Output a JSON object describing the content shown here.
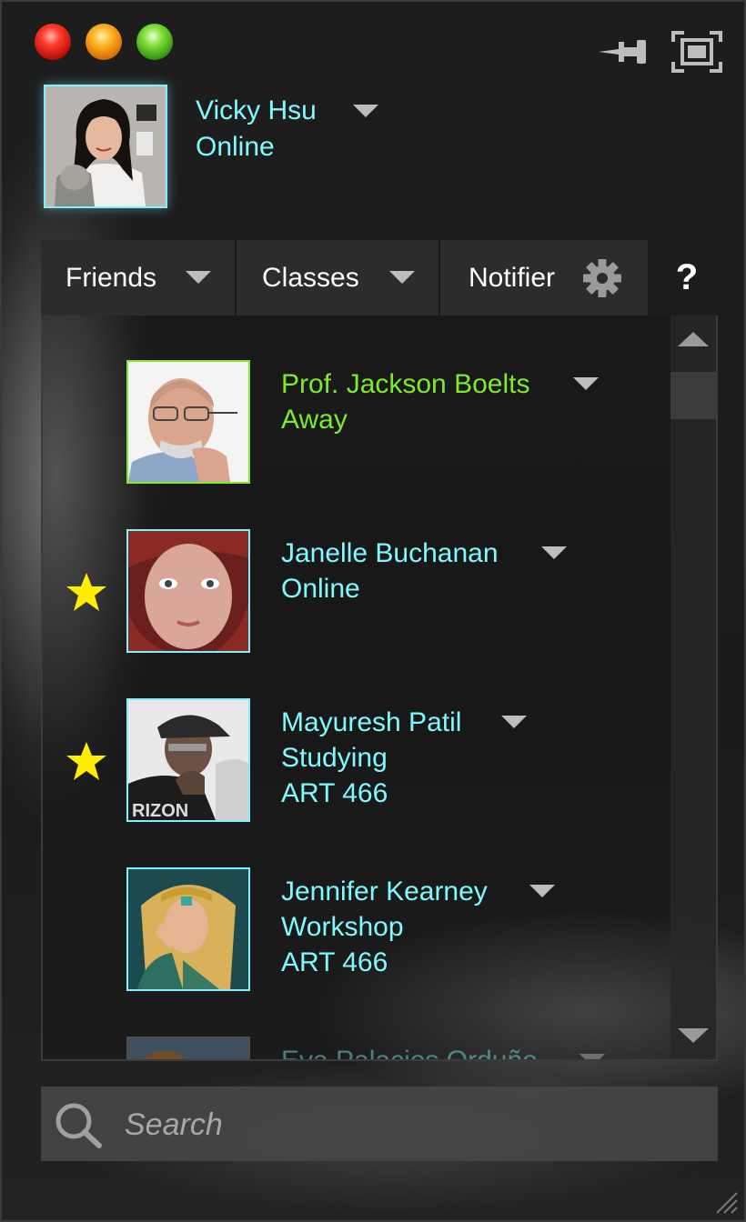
{
  "window": {
    "controls": {
      "close": "close",
      "minimize": "minimize",
      "zoom": "zoom"
    },
    "icons": {
      "pin": "pin-icon",
      "fullscreen": "fullscreen-icon"
    }
  },
  "profile": {
    "name": "Vicky Hsu",
    "status": "Online",
    "status_color": "#7ff8ff"
  },
  "tabs": [
    {
      "label": "Friends",
      "has_dropdown": true
    },
    {
      "label": "Classes",
      "has_dropdown": true
    },
    {
      "label": "Notifier",
      "icon": "gear-icon"
    }
  ],
  "help_label": "?",
  "contacts": [
    {
      "name": "Prof. Jackson Boelts",
      "status": "Away",
      "course": "",
      "favorite": false,
      "status_color": "#7dea2c"
    },
    {
      "name": "Janelle Buchanan",
      "status": "Online",
      "course": "",
      "favorite": true,
      "status_color": "#7ff8ff"
    },
    {
      "name": "Mayuresh Patil",
      "status": "Studying",
      "course": "ART 466",
      "favorite": true,
      "status_color": "#7ff8ff"
    },
    {
      "name": "Jennifer Kearney",
      "status": "Workshop",
      "course": "ART 466",
      "favorite": false,
      "status_color": "#7ff8ff"
    },
    {
      "name": "Eva Palacios Orduño",
      "status": "",
      "course": "",
      "favorite": false,
      "status_color": "#7ff8ff"
    }
  ],
  "search": {
    "placeholder": "Search",
    "value": ""
  }
}
